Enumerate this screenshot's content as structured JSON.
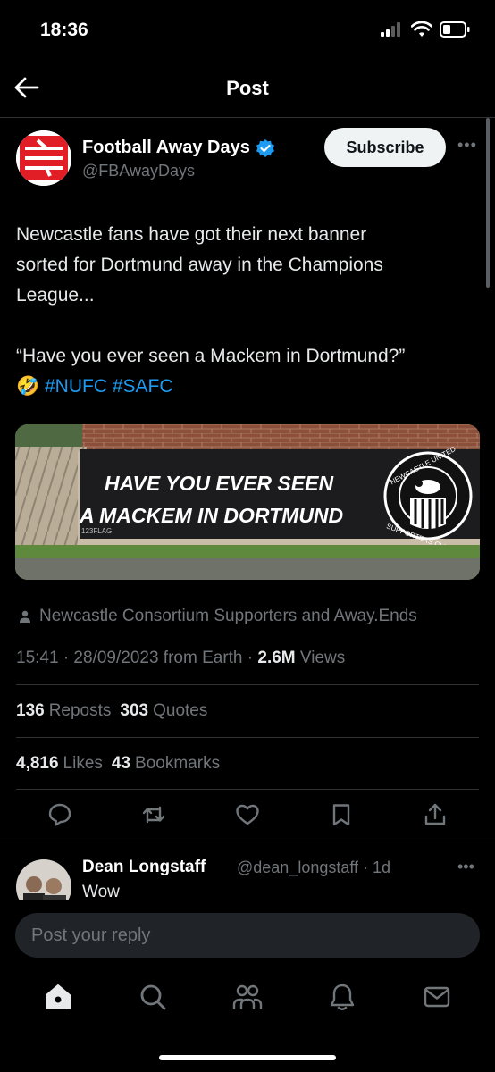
{
  "status_bar": {
    "time": "18:36"
  },
  "header": {
    "title": "Post"
  },
  "post": {
    "author_name": "Football Away Days",
    "author_handle": "@FBAwayDays",
    "subscribe_label": "Subscribe",
    "text_line1": "Newcastle fans have got their next banner",
    "text_line2": "sorted for Dortmund away in the Champions",
    "text_line3": "League...",
    "quote_line": "“Have you ever seen a Mackem in Dortmund?”",
    "emoji": "🤣",
    "hashtag1": "#NUFC",
    "hashtag2": "#SAFC",
    "image": {
      "banner_line1": "HAVE YOU EVER SEEN",
      "banner_line2": "A MACKEM IN DORTMUND",
      "banner_small": "123FLAG",
      "badge_top": "NEWCASTLE UNITED",
      "badge_bottom": "SUPPORTERS CLUB"
    },
    "tagged_users": "Newcastle Consortium Supporters and Away.Ends",
    "timestamp": "15:41 · 28/09/2023 from Earth · ",
    "views_count": "2.6M",
    "views_label": "Views",
    "reposts_count": "136",
    "reposts_label": "Reposts",
    "quotes_count": "303",
    "quotes_label": "Quotes",
    "likes_count": "4,816",
    "likes_label": "Likes",
    "bookmarks_count": "43",
    "bookmarks_label": "Bookmarks"
  },
  "reply": {
    "name": "Dean Longstaff",
    "handle": "@dean_longstaff · 1d",
    "text": "Wow"
  },
  "reply_bar": {
    "placeholder": "Post your reply"
  },
  "colors": {
    "accent": "#1d9bf0",
    "background": "#000000",
    "muted": "#71767b"
  },
  "icons": [
    "back-arrow-icon",
    "verified-badge-icon",
    "more-icon",
    "person-icon",
    "reply-icon",
    "repost-icon",
    "like-icon",
    "bookmark-icon",
    "share-icon",
    "home-icon",
    "search-icon",
    "communities-icon",
    "notifications-icon",
    "messages-icon"
  ]
}
